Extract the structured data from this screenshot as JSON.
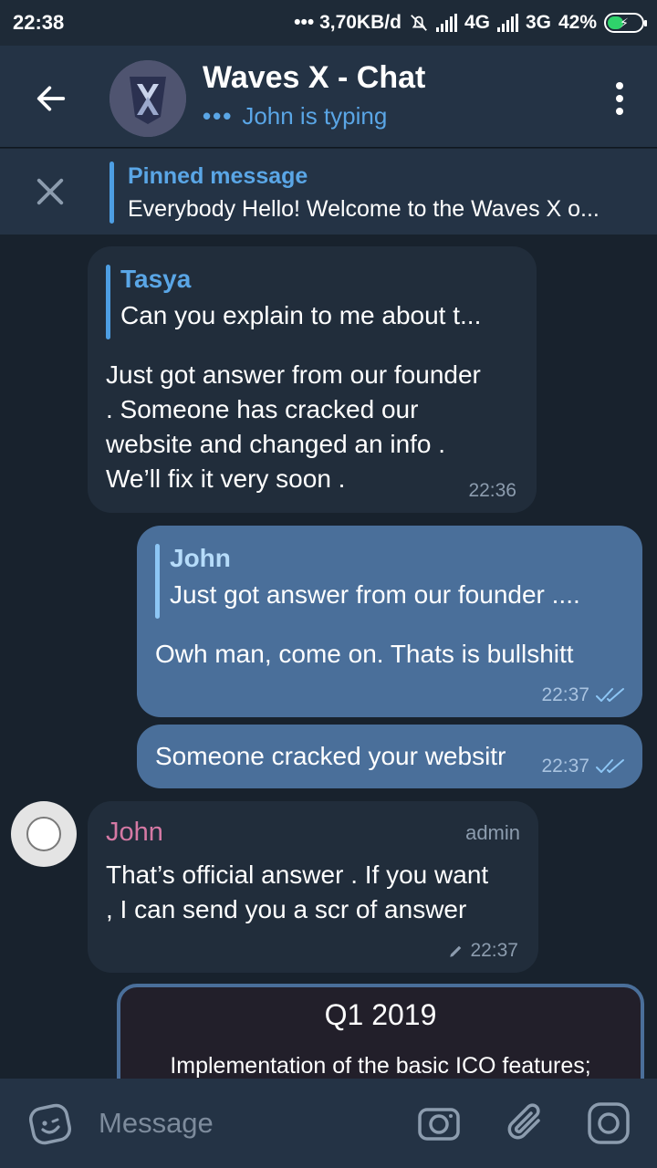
{
  "status": {
    "time": "22:38",
    "net_speed": "••• 3,70KB/d",
    "net1": "4G",
    "net2": "3G",
    "battery": "42%"
  },
  "header": {
    "title": "Waves X - Chat",
    "typing_dots": "•••",
    "typing": "John is typing"
  },
  "pinned": {
    "title": "Pinned message",
    "text": "Everybody Hello!  Welcome to the Waves X o..."
  },
  "messages": {
    "m1": {
      "reply_name": "Tasya",
      "reply_text": "Can you explain to me about t...",
      "line1": "Just got answer from our founder",
      "line2": ". Someone has cracked our",
      "line3": "website and changed an info .",
      "line4": "We’ll fix it very soon .",
      "time": "22:36"
    },
    "m2": {
      "reply_name": "John",
      "reply_text": "Just got answer from our founder ....",
      "text": "Owh man, come on. Thats is bullshitt",
      "time": "22:37"
    },
    "m3": {
      "text": "Someone cracked your websitr",
      "time": "22:37"
    },
    "m4": {
      "sender": "John",
      "role": "admin",
      "line1": "That’s official answer . If you want",
      "line2": ", I can send you a scr of answer",
      "time": "22:37"
    },
    "m5": {
      "title": "Q1 2019",
      "line1": "Implementation of the basic ICO features;"
    }
  },
  "input": {
    "placeholder": "Message"
  },
  "colors": {
    "background": "#18222d",
    "header": "#243345",
    "incoming_bubble": "#212d3b",
    "outgoing_bubble": "#4a6f9a",
    "accent": "#5aa6e6",
    "sender_name": "#d579a4"
  }
}
